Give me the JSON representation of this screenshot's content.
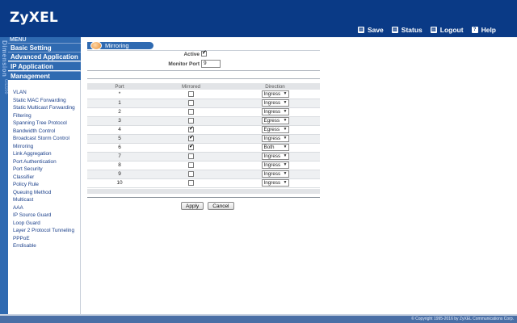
{
  "header": {
    "logo": "ZyXEL",
    "nav": [
      {
        "label": "Save",
        "icon": "save-icon",
        "glyph": "▤"
      },
      {
        "label": "Status",
        "icon": "status-icon",
        "glyph": "▤"
      },
      {
        "label": "Logout",
        "icon": "logout-icon",
        "glyph": "▤"
      },
      {
        "label": "Help",
        "icon": "help-icon",
        "glyph": "?"
      }
    ]
  },
  "sidebar": {
    "brand": "Dimension",
    "model": "GS2200",
    "menu_title": "MENU",
    "categories": [
      "Basic Setting",
      "Advanced Application",
      "IP Application",
      "Management"
    ],
    "items": [
      "VLAN",
      "Static MAC Forwarding",
      "Static Multicast Forwarding",
      "Filtering",
      "Spanning Tree Protocol",
      "Bandwidth Control",
      "Broadcast Storm Control",
      "Mirroring",
      "Link Aggregation",
      "Port Authentication",
      "Port Security",
      "Classifier",
      "Policy Rule",
      "Queuing Method",
      "Multicast",
      "AAA",
      "IP Source Guard",
      "Loop Guard",
      "Layer 2 Protocol Tunneling",
      "PPPoE",
      "Errdisable"
    ]
  },
  "page": {
    "title": "Mirroring",
    "active_label": "Active",
    "active_checked": true,
    "monitor_port_label": "Monitor Port",
    "monitor_port_value": "9"
  },
  "table": {
    "headers": [
      "Port",
      "Mirrored",
      "Direction"
    ],
    "rows": [
      {
        "port": "*",
        "mirrored": false,
        "direction": "Ingress"
      },
      {
        "port": "1",
        "mirrored": false,
        "direction": "Ingress"
      },
      {
        "port": "2",
        "mirrored": false,
        "direction": "Ingress"
      },
      {
        "port": "3",
        "mirrored": false,
        "direction": "Egress"
      },
      {
        "port": "4",
        "mirrored": true,
        "direction": "Egress"
      },
      {
        "port": "5",
        "mirrored": true,
        "direction": "Ingress"
      },
      {
        "port": "6",
        "mirrored": true,
        "direction": "Both"
      },
      {
        "port": "7",
        "mirrored": false,
        "direction": "Ingress"
      },
      {
        "port": "8",
        "mirrored": false,
        "direction": "Ingress"
      },
      {
        "port": "9",
        "mirrored": false,
        "direction": "Ingress"
      },
      {
        "port": "10",
        "mirrored": false,
        "direction": "Ingress"
      }
    ]
  },
  "buttons": {
    "apply": "Apply",
    "cancel": "Cancel"
  },
  "footer": {
    "copyright": "© Copyright 1995-2016 by ZyXEL Communications Corp."
  },
  "colors": {
    "header": "#0a3a86",
    "sidebar": "#2f6ab1",
    "footer": "#4a6fa6"
  }
}
